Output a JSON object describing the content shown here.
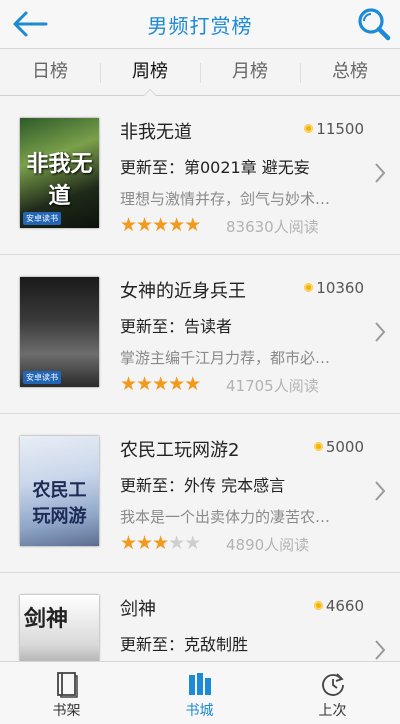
{
  "header": {
    "title": "男频打赏榜",
    "back_icon": "back-arrow-icon",
    "search_icon": "search-icon",
    "accent": "#1c8ad6"
  },
  "tabs": [
    {
      "label": "日榜",
      "active": false
    },
    {
      "label": "周榜",
      "active": true
    },
    {
      "label": "月榜",
      "active": false
    },
    {
      "label": "总榜",
      "active": false
    }
  ],
  "books": [
    {
      "title": "非我无道",
      "coins": "11500",
      "update": "更新至：第0021章 避无妄",
      "desc": "理想与激情并存，剑气与妙术…",
      "rating": 5,
      "reads": "83630人阅读",
      "cover_text": "非我无道",
      "cover_tag": "安卓读书"
    },
    {
      "title": "女神的近身兵王",
      "coins": "10360",
      "update": "更新至：告读者",
      "desc": "掌游主编千江月力荐，都市必…",
      "rating": 5,
      "reads": "41705人阅读",
      "cover_text": "",
      "cover_tag": "安卓读书"
    },
    {
      "title": "农民工玩网游2",
      "coins": "5000",
      "update": "更新至：外传 完本感言",
      "desc": "我本是一个出卖体力的凄苦农…",
      "rating": 3,
      "reads": "4890人阅读",
      "cover_text": "农民工玩网游",
      "cover_tag": ""
    },
    {
      "title": "剑神",
      "coins": "4660",
      "update": "更新至：克敌制胜",
      "desc": "",
      "rating": 0,
      "reads": "",
      "cover_text": "剑神",
      "cover_tag": ""
    }
  ],
  "bottom_nav": [
    {
      "label": "书架",
      "icon": "bookshelf-icon",
      "active": false
    },
    {
      "label": "书城",
      "icon": "bookstore-icon",
      "active": true
    },
    {
      "label": "上次",
      "icon": "history-icon",
      "active": false
    }
  ]
}
